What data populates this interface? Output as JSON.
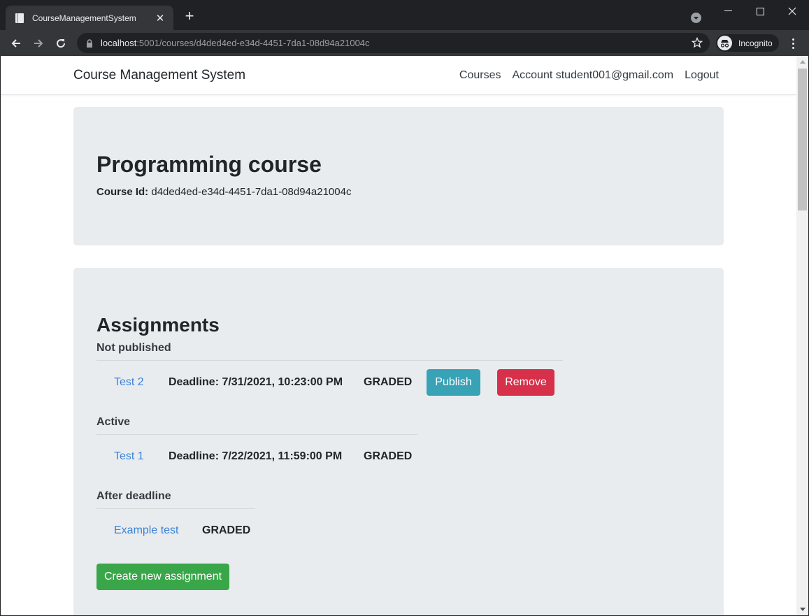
{
  "browser": {
    "tab_title": "CourseManagementSystem",
    "new_tab_symbol": "+",
    "url_host": "localhost",
    "url_rest": ":5001/courses/d4ded4ed-e34d-4451-7da1-08d94a21004c",
    "incognito_label": "Incognito"
  },
  "site": {
    "brand": "Course Management System",
    "nav": {
      "courses": "Courses",
      "account": "Account student001@gmail.com",
      "logout": "Logout"
    }
  },
  "course": {
    "title": "Programming course",
    "id_label": "Course Id:",
    "id_value": "d4ded4ed-e34d-4451-7da1-08d94a21004c"
  },
  "assignments": {
    "title": "Assignments",
    "not_published": {
      "label": "Not published",
      "items": [
        {
          "name": "Test 2",
          "deadline": "Deadline: 7/31/2021, 10:23:00 PM",
          "status": "GRADED",
          "publish_label": "Publish",
          "remove_label": "Remove"
        }
      ]
    },
    "active": {
      "label": "Active",
      "items": [
        {
          "name": "Test 1",
          "deadline": "Deadline: 7/22/2021, 11:59:00 PM",
          "status": "GRADED"
        }
      ]
    },
    "after_deadline": {
      "label": "After deadline",
      "items": [
        {
          "name": "Example test",
          "status": "GRADED"
        }
      ]
    },
    "create_label": "Create new assignment"
  },
  "colors": {
    "publish": "#38a2b6",
    "remove": "#d6304a",
    "create": "#3aa64a",
    "link": "#3b82d6",
    "jumbotron": "#e9ecef"
  }
}
